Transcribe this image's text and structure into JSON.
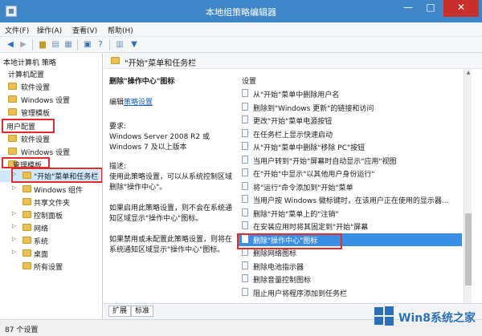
{
  "window": {
    "title": "本地组策略编辑器",
    "min_glyph": "—",
    "max_glyph": "□",
    "close_glyph": "✕"
  },
  "menu": [
    "文件(F)",
    "操作(A)",
    "查看(V)",
    "帮助(H)"
  ],
  "toolbar_icons": [
    "back-arrow-icon",
    "forward-arrow-icon",
    "up-folder-icon",
    "show-tree-icon",
    "export-list-icon",
    "properties-icon",
    "help-icon",
    "show-hide-icon",
    "filter-icon"
  ],
  "tree": {
    "root": "本地计算机 策略",
    "computer_config": "计算机配置",
    "software_settings_1": "软件设置",
    "windows_settings_1": "Windows 设置",
    "admin_templates_1": "管理模板",
    "user_config": "用户配置",
    "software_settings_2": "软件设置",
    "windows_settings_2": "Windows 设置",
    "admin_templates_2": "管理模板",
    "start_menu": "\"开始\"菜单和任务栏",
    "windows_components": "Windows 组件",
    "shared_folders": "共享文件夹",
    "control_panel": "控制面板",
    "network": "网络",
    "system": "系统",
    "desktop": "桌面",
    "all_settings": "所有设置"
  },
  "right_pane": {
    "header": "\"开始\"菜单和任务栏",
    "setting_title": "删除\"操作中心\"图标",
    "edit_prefix": "编辑",
    "edit_link": "策略设置",
    "requirements_label": "要求:",
    "requirements_text": "Windows Server 2008 R2 或 Windows 7 及以上版本",
    "description_label": "描述:",
    "description_text": "使用此策略设置，可以从系统控制区域删除\"操作中心\"。",
    "description_text2": "如果启用此策略设置，则不会在系统通知区域显示\"操作中心\"图标。",
    "description_text3": "如果禁用或未配置此策略设置，则将在系统通知区域显示\"操作中心\"图标。",
    "settings_header": "设置",
    "settings": [
      "从\"开始\"菜单中删除用户名",
      "删除到\"Windows 更新\"的链接和访问",
      "更改\"开始\"菜单电源按钮",
      "在任务栏上显示快速启动",
      "从\"开始\"菜单中删除\"移除 PC\"按钮",
      "当用户转到\"开始\"屏幕时自动显示\"应用\"视图",
      "在\"开始\"中显示\"以其他用户身份运行\"",
      "将\"运行\"命令添加到\"开始\"菜单",
      "当用户按 Windows 徽标键时，在该用户正在使用的显示器...",
      "删除\"开始\"菜单上的\"注销\"",
      "在安装应用时将其固定到\"开始\"屏幕",
      "删除\"操作中心\"图标",
      "删除网络图标",
      "删除电池指示器",
      "删除音量控制图标",
      "阻止用户将程序添加到任务栏"
    ],
    "selected_setting_index": 11,
    "tabs": [
      "扩展",
      "标准"
    ]
  },
  "status": {
    "text": "87 个设置"
  },
  "watermark": {
    "text": "Win8系统之家"
  },
  "colors": {
    "titlebar": "#3f86c8",
    "highlight_box": "#e52b2b",
    "selection": "#3a8ee6"
  }
}
